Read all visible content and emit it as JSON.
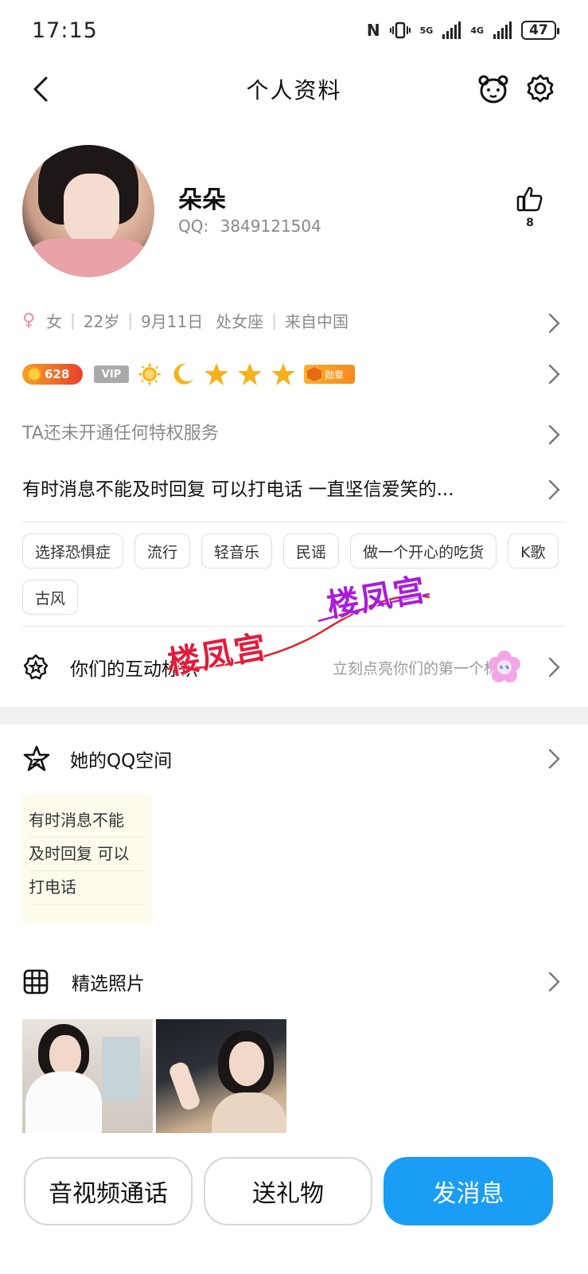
{
  "status_bar": {
    "time": "17:15",
    "nfc": "N",
    "net1": "5G",
    "net2": "4G",
    "battery": "47"
  },
  "nav": {
    "title": "个人资料",
    "back_icon": "chevron-left-icon",
    "pet_icon": "bear-face-icon",
    "settings_icon": "gear-icon"
  },
  "profile": {
    "name": "朵朵",
    "qq_label": "QQ:",
    "qq_number": "3849121504",
    "likes": "8",
    "gender_symbol": "♀",
    "gender": "女",
    "age": "22岁",
    "birthday": "9月11日",
    "zodiac": "处女座",
    "location": "来自中国"
  },
  "badges": {
    "level_points": "628",
    "vip": "VIP",
    "medal": "勋章",
    "level_icons": [
      "sun-icon",
      "moon-icon",
      "star-icon",
      "star-icon",
      "star-icon"
    ]
  },
  "privilege_text": "TA还未开通任何特权服务",
  "signature": "有时消息不能及时回复  可以打电话  一直坚信爱笑的...",
  "tags": [
    "选择恐惧症",
    "流行",
    "轻音乐",
    "民谣",
    "做一个开心的吃货",
    "K歌",
    "古风"
  ],
  "interaction": {
    "label": "你们的互动标识",
    "hint": "立刻点亮你们的第一个标识"
  },
  "watermark": {
    "text1": "楼凤宫",
    "text2": "楼凤宫",
    "color1": "#e31b3a",
    "color2": "#a81dd8"
  },
  "qzone": {
    "label": "她的QQ空间",
    "note_lines": [
      "有时消息不能",
      "及时回复  可以",
      "打电话"
    ]
  },
  "photos": {
    "label": "精选照片"
  },
  "actions": {
    "call": "音视频通话",
    "gift": "送礼物",
    "message": "发消息",
    "accent": "#1a9df4"
  }
}
